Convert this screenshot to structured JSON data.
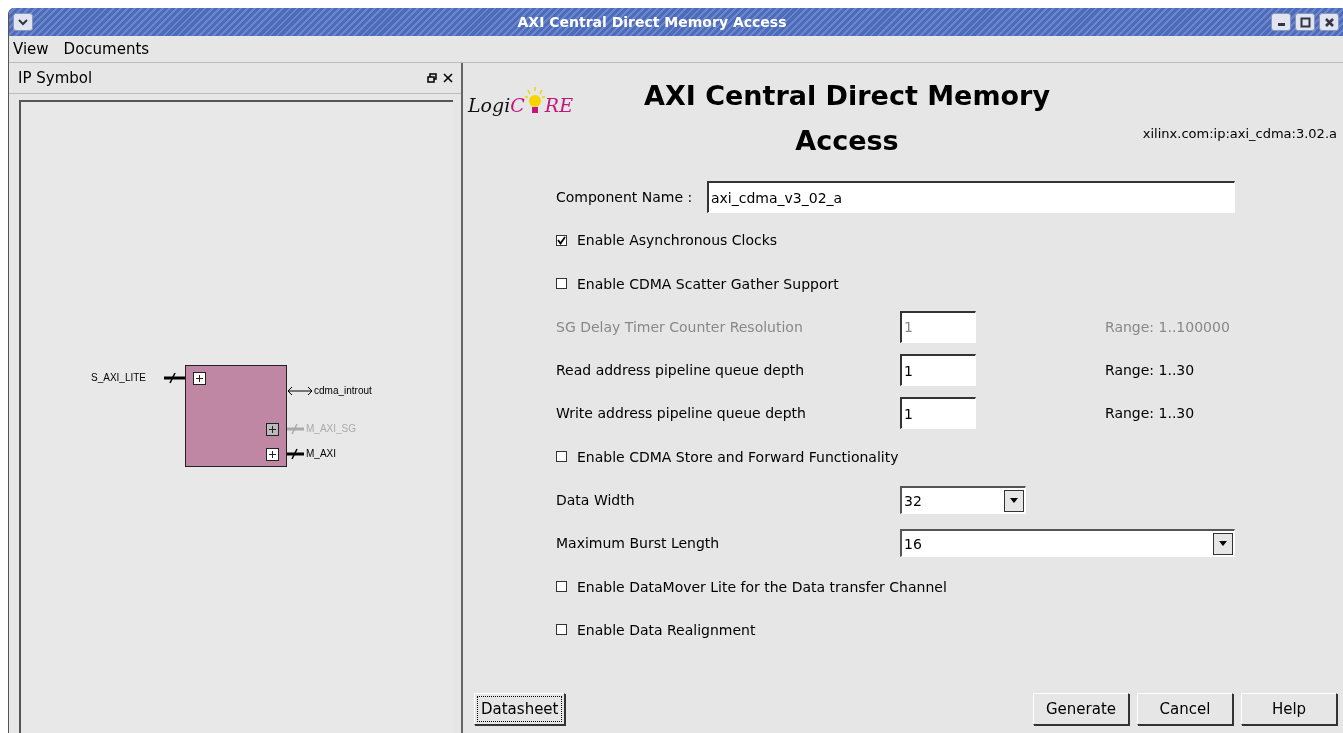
{
  "window": {
    "title": "AXI Central Direct Memory Access"
  },
  "menu": [
    {
      "label": "View"
    },
    {
      "label": "Documents"
    }
  ],
  "ip_symbol_panel": {
    "title": "IP Symbol",
    "block": {
      "ports_left": [
        {
          "kind": "bus",
          "label": "S_AXI_LITE",
          "disabled": false
        }
      ],
      "ports_right": [
        {
          "kind": "signal",
          "label": "cdma_introut",
          "disabled": false
        },
        {
          "kind": "bus",
          "label": "M_AXI_SG",
          "disabled": true
        },
        {
          "kind": "bus",
          "label": "M_AXI",
          "disabled": false
        }
      ]
    }
  },
  "header": {
    "logo": {
      "part_1": "Logi",
      "part_2": "C",
      "part_3": "RE"
    },
    "title": "AXI Central Direct Memory Access",
    "vlnv": "xilinx.com:ip:axi_cdma:3.02.a"
  },
  "form": [
    {
      "kind": "text",
      "label": "Component Name :",
      "value": "axi_cdma_v3_02_a"
    },
    {
      "kind": "checkbox",
      "label": "Enable Asynchronous Clocks",
      "checked": true
    },
    {
      "kind": "checkbox",
      "label": "Enable CDMA Scatter Gather Support",
      "checked": false
    },
    {
      "kind": "number",
      "label": "SG Delay Timer Counter Resolution",
      "value": "1",
      "range": "Range: 1..100000",
      "disabled": true
    },
    {
      "kind": "number",
      "label": "Read address pipeline queue depth",
      "value": "1",
      "range": "Range: 1..30",
      "disabled": false
    },
    {
      "kind": "number",
      "label": "Write address pipeline queue depth",
      "value": "1",
      "range": "Range: 1..30",
      "disabled": false
    },
    {
      "kind": "checkbox",
      "label": "Enable CDMA Store and Forward Functionality",
      "checked": false
    },
    {
      "kind": "select",
      "label": "Data Width",
      "value": "32",
      "wide": false
    },
    {
      "kind": "select",
      "label": "Maximum Burst Length",
      "value": "16",
      "wide": true
    },
    {
      "kind": "checkbox",
      "label": "Enable DataMover Lite for the Data transfer Channel",
      "checked": false
    },
    {
      "kind": "checkbox",
      "label": "Enable Data Realignment",
      "checked": false
    }
  ],
  "buttons_left": [
    {
      "label": "Datasheet",
      "focused": true
    }
  ],
  "buttons_right": [
    {
      "label": "Generate",
      "focused": false
    },
    {
      "label": "Cancel",
      "focused": false
    },
    {
      "label": "Help",
      "focused": false
    }
  ]
}
